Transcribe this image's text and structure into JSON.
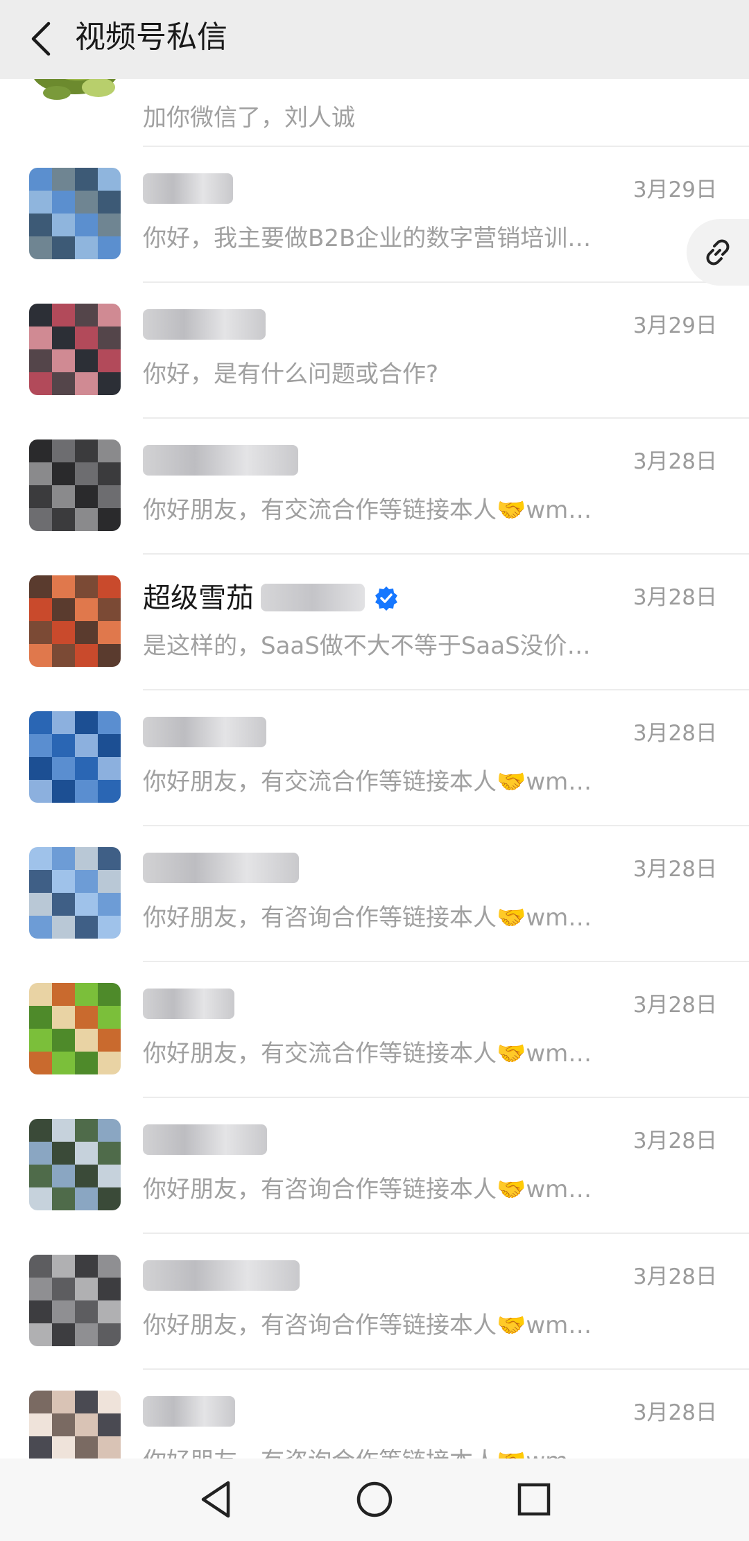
{
  "header": {
    "title": "视频号私信"
  },
  "top_partial": {
    "message": "加你微信了，刘人诚"
  },
  "conversations": [
    {
      "name": "",
      "date": "3月29日",
      "message": "你好，我主要做B2B企业的数字营销培训…",
      "avatar_colors": [
        "#5b8fcf",
        "#8fb5dd",
        "#3d5a76",
        "#6f8592"
      ]
    },
    {
      "name": "",
      "date": "3月29日",
      "message": "你好，是有什么问题或合作?",
      "avatar_colors": [
        "#b24a5a",
        "#2c2f36",
        "#d08a93",
        "#54454a"
      ]
    },
    {
      "name": "",
      "date": "3月28日",
      "message": "你好朋友，有交流合作等链接本人🤝wm…",
      "avatar_colors": [
        "#3b3b3d",
        "#6d6d70",
        "#2a2a2c",
        "#8a8a8c"
      ]
    },
    {
      "name": "超级雪茄",
      "date": "3月28日",
      "message": "是这样的，SaaS做不大不等于SaaS没价…",
      "avatar_colors": [
        "#c94a2c",
        "#7b4a35",
        "#e0784c",
        "#5a3b2e"
      ],
      "verified": true
    },
    {
      "name": "",
      "date": "3月28日",
      "message": "你好朋友，有交流合作等链接本人🤝wm…",
      "avatar_colors": [
        "#2a66b4",
        "#5a8ed0",
        "#1c4f93",
        "#8cb0de"
      ]
    },
    {
      "name": "",
      "date": "3月28日",
      "message": "你好朋友，有咨询合作等链接本人🤝wm…",
      "avatar_colors": [
        "#6d9cd6",
        "#9fc2ea",
        "#3f5f86",
        "#b9c8d6"
      ]
    },
    {
      "name": "",
      "date": "3月28日",
      "message": "你好朋友，有交流合作等链接本人🤝wm…",
      "avatar_colors": [
        "#7bbf3a",
        "#c96a2e",
        "#e9d3a4",
        "#4e8a2a"
      ]
    },
    {
      "name": "",
      "date": "3月28日",
      "message": "你好朋友，有咨询合作等链接本人🤝wm…",
      "avatar_colors": [
        "#8aa6c2",
        "#4f6b4a",
        "#c6d2dc",
        "#3a4a38"
      ]
    },
    {
      "name": "",
      "date": "3月28日",
      "message": "你好朋友，有咨询合作等链接本人🤝wm…",
      "avatar_colors": [
        "#5d5d60",
        "#8f8f92",
        "#3d3d40",
        "#b0b0b2"
      ]
    },
    {
      "name": "",
      "date": "3月28日",
      "message": "你好朋友，有咨询合作等链接本人🤝wm…",
      "avatar_colors": [
        "#d9c3b5",
        "#7a6a62",
        "#efe3da",
        "#4a4a52"
      ]
    }
  ],
  "icons": {
    "back": "chevron-left-icon",
    "link": "link-icon",
    "verified": "verified-badge-icon",
    "nav_back": "triangle-back-icon",
    "nav_home": "circle-home-icon",
    "nav_recent": "square-recent-icon"
  },
  "colors": {
    "header_bg": "#ededed",
    "verified_blue": "#1677ff",
    "date_gray": "#9b9b9b"
  }
}
